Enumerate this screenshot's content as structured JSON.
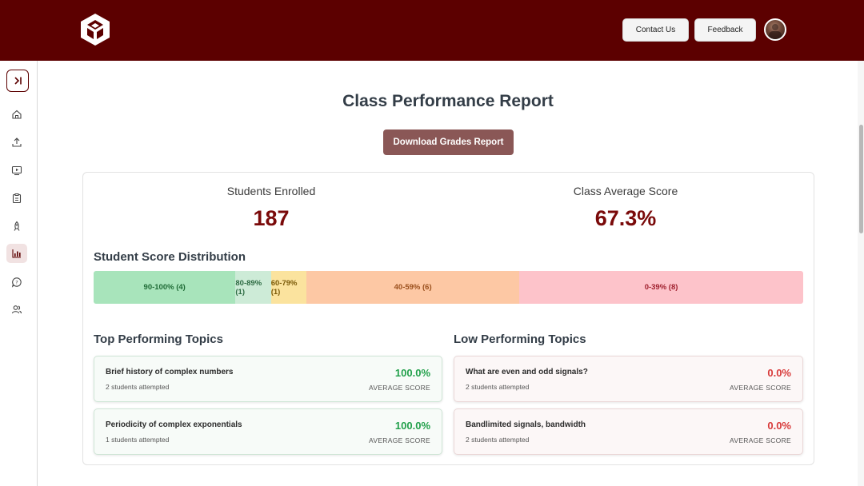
{
  "header": {
    "contact_label": "Contact Us",
    "feedback_label": "Feedback",
    "brand_color": "#5c0000"
  },
  "sidebar": {
    "items": [
      {
        "icon": "home-icon"
      },
      {
        "icon": "upload-icon"
      },
      {
        "icon": "video-icon"
      },
      {
        "icon": "clipboard-icon"
      },
      {
        "icon": "rocket-icon"
      },
      {
        "icon": "bar-chart-icon",
        "active": true
      },
      {
        "icon": "help-chat-icon"
      },
      {
        "icon": "users-icon"
      }
    ]
  },
  "main": {
    "title": "Class Performance Report",
    "download_label": "Download Grades Report",
    "stats": {
      "enrolled_label": "Students Enrolled",
      "enrolled_value": "187",
      "average_label": "Class Average Score",
      "average_value": "67.3%"
    },
    "distribution": {
      "title": "Student Score Distribution",
      "segments": [
        {
          "label": "90-100% (4)",
          "count": 4,
          "bg": "#a8e4bb",
          "fg": "#1f6b36"
        },
        {
          "label": "80-89% (1)",
          "count": 1,
          "bg": "#cdebd7",
          "fg": "#2d6b43"
        },
        {
          "label": "60-79% (1)",
          "count": 1,
          "bg": "#fbe39e",
          "fg": "#7a5a08"
        },
        {
          "label": "40-59% (6)",
          "count": 6,
          "bg": "#fdc8a4",
          "fg": "#9a4f1c"
        },
        {
          "label": "0-39% (8)",
          "count": 8,
          "bg": "#fdc3ca",
          "fg": "#a0202e"
        }
      ]
    },
    "top_topics": {
      "title": "Top Performing Topics",
      "items": [
        {
          "name": "Brief history of complex numbers",
          "attempted": "2 students attempted",
          "score": "100.0%",
          "score_label": "AVERAGE SCORE"
        },
        {
          "name": "Periodicity of complex exponentials",
          "attempted": "1 students attempted",
          "score": "100.0%",
          "score_label": "AVERAGE SCORE"
        }
      ]
    },
    "low_topics": {
      "title": "Low Performing Topics",
      "items": [
        {
          "name": "What are even and odd signals?",
          "attempted": "2 students attempted",
          "score": "0.0%",
          "score_label": "AVERAGE SCORE"
        },
        {
          "name": "Bandlimited signals, bandwidth",
          "attempted": "2 students attempted",
          "score": "0.0%",
          "score_label": "AVERAGE SCORE"
        }
      ]
    }
  }
}
